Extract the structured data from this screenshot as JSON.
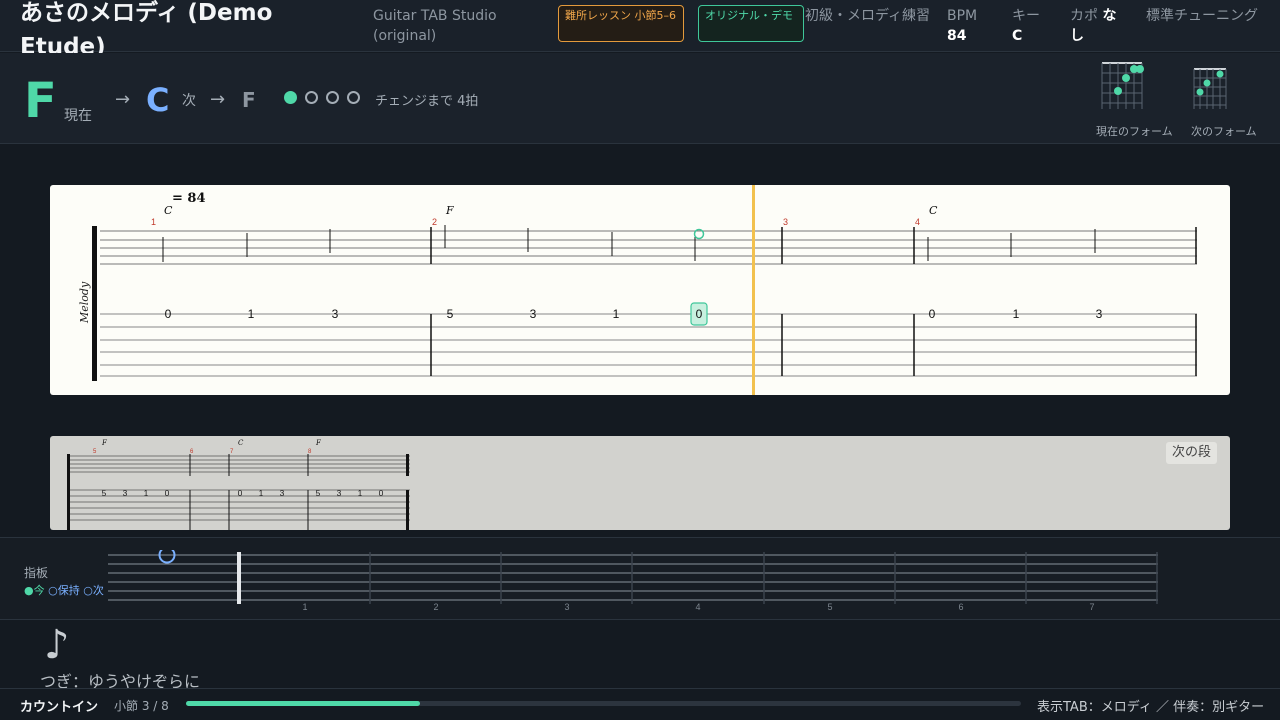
{
  "header": {
    "song_title": "あさのメロディ (Demo Etude)",
    "app_name": "Guitar TAB Studio (original)",
    "badge_lesson": "難所レッスン 小節5–6",
    "badge_original": "オリジナル・デモ",
    "level": "初級・メロディ練習",
    "bpm_label": "BPM",
    "bpm_value": "84",
    "key_label": "キー",
    "key_value": "C",
    "capo_label": "カポ",
    "capo_value": "なし",
    "tuning": "標準チューニング"
  },
  "chords": {
    "current": "F",
    "current_label": "現在",
    "arrow": "→",
    "next": "C",
    "next_label": "次",
    "after": "F",
    "beats_total": 4,
    "beats_active": 1,
    "countdown": "チェンジまで 4拍",
    "current_form_label": "現在のフォーム",
    "next_form_label": "次のフォーム"
  },
  "score": {
    "tempo": "= 84",
    "track_name": "Melody",
    "measures": [
      {
        "number": "1",
        "chord": "C",
        "frets": [
          "0",
          "1",
          "3"
        ]
      },
      {
        "number": "2",
        "chord": "F",
        "frets": [
          "5",
          "3",
          "1",
          "0"
        ]
      },
      {
        "number": "3",
        "chord": "",
        "frets": []
      },
      {
        "number": "4",
        "chord": "C",
        "frets": [
          "0",
          "1",
          "3"
        ]
      }
    ]
  },
  "next_system": {
    "button": "次の段",
    "chords": [
      "F",
      "C",
      "F"
    ],
    "measure_numbers": [
      "5",
      "6",
      "7",
      "8"
    ],
    "frets": [
      "5",
      "3",
      "1",
      "0",
      "0",
      "1",
      "3",
      "5",
      "3",
      "1",
      "0"
    ]
  },
  "fretboard": {
    "title": "指板",
    "legend_now": "●今",
    "legend_hold": "○保持",
    "legend_next": "○次",
    "fret_numbers": [
      "1",
      "2",
      "3",
      "4",
      "5",
      "6",
      "7"
    ]
  },
  "lyrics": {
    "note_icon": "♪",
    "next_line": "つぎ：ゆうやけぞらに"
  },
  "footer": {
    "countin": "カウントイン",
    "measure_position": "小節 3 / 8",
    "progress": 0.28,
    "display_info": "表示TAB：メロディ ／ 伴奏：別ギター"
  },
  "colors": {
    "accent_green": "#4fd8a8",
    "accent_blue": "#7ab0ff",
    "playhead": "#f2c14e",
    "badge_orange": "#e39a3c"
  }
}
